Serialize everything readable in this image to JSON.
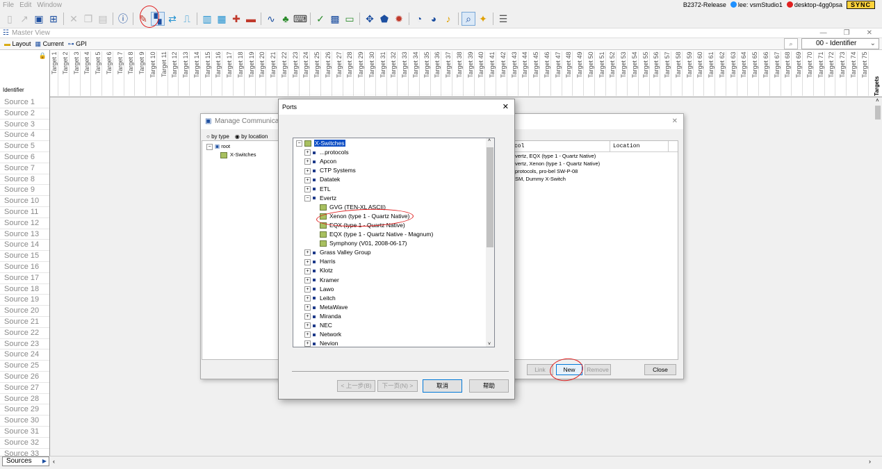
{
  "menu": {
    "items": [
      "File",
      "Edit",
      "Window"
    ]
  },
  "status": {
    "build": "B2372-Release",
    "user": "lee: vsmStudio1",
    "host": "desktop-4gg0psa",
    "sync": "SYNC",
    "user_color": "#1e90ff",
    "host_color": "#e02020"
  },
  "toolbar": {
    "icons": [
      "new-icon",
      "open-icon",
      "save-icon",
      "save-all-icon",
      "delete-icon",
      "copy-icon",
      "paste-icon",
      "info-icon",
      "tools-icon",
      "comm-manager-icon",
      "routing-icon",
      "gpi-icon",
      "panel-icon",
      "matrix-icon",
      "plug-icon",
      "device-icon",
      "signal-icon",
      "tally-icon",
      "keyboard-icon",
      "folder-icon",
      "grid-icon",
      "card-icon",
      "network-icon",
      "shield-icon",
      "gear-icon",
      "timer-icon",
      "clock-icon",
      "note-icon",
      "search-icon",
      "wizard-icon",
      "list-icon"
    ]
  },
  "master_view": {
    "title": "Master View"
  },
  "tabs": [
    {
      "label": "Layout"
    },
    {
      "label": "Current"
    },
    {
      "label": "GPI"
    }
  ],
  "identifier": {
    "selected": "00 - Identifier",
    "label": "Identifier"
  },
  "targets": [
    "Target 1",
    "Target 2",
    "Target 3",
    "Target 4",
    "Target 5",
    "Target 6",
    "Target 7",
    "Target 8",
    "Target 9",
    "Target 10",
    "Target 11",
    "Target 12",
    "Target 13",
    "Target 14",
    "Target 15",
    "Target 16",
    "Target 17",
    "Target 18",
    "Target 19",
    "Target 20",
    "Target 21",
    "Target 22",
    "Target 23",
    "Target 24",
    "Target 25",
    "Target 26",
    "Target 27",
    "Target 28",
    "Target 29",
    "Target 30",
    "Target 31",
    "Target 32",
    "Target 33",
    "Target 34",
    "Target 35",
    "Target 36",
    "Target 37",
    "Target 38",
    "Target 39",
    "Target 40",
    "Target 41",
    "Target 42",
    "Target 43",
    "Target 44",
    "Target 45",
    "Target 46",
    "Target 47",
    "Target 48",
    "Target 49",
    "Target 50",
    "Target 51",
    "Target 52",
    "Target 53",
    "Target 54",
    "Target 55",
    "Target 56",
    "Target 57",
    "Target 58",
    "Target 59",
    "Target 60",
    "Target 61",
    "Target 62",
    "Target 63",
    "Target 64",
    "Target 65",
    "Target 66",
    "Target 67",
    "Target 68",
    "Target 69",
    "Target 70",
    "Target 71",
    "Target 72",
    "Target 73",
    "Target 74",
    "Target 75"
  ],
  "targets_tab": "Targets",
  "sources": [
    "Source 1",
    "Source 2",
    "Source 3",
    "Source 4",
    "Source 5",
    "Source 6",
    "Source 7",
    "Source 8",
    "Source 9",
    "Source 10",
    "Source 11",
    "Source 12",
    "Source 13",
    "Source 14",
    "Source 15",
    "Source 16",
    "Source 17",
    "Source 18",
    "Source 19",
    "Source 20",
    "Source 21",
    "Source 22",
    "Source 23",
    "Source 24",
    "Source 25",
    "Source 26",
    "Source 27",
    "Source 28",
    "Source 29",
    "Source 30",
    "Source 31",
    "Source 32",
    "Source 33"
  ],
  "sources_button": "Sources",
  "manage_dialog": {
    "title": "Manage Communication",
    "by_type": "by type",
    "by_location": "by location",
    "tree": {
      "root": "root",
      "child": "X-Switches"
    },
    "columns": {
      "protocol": "col",
      "location": "Location"
    },
    "rows": [
      "vertz, EQX (type 1 - Quartz Native)",
      "vertz, Xenon (type 1 - Quartz Native)",
      "protocols, pro-bel SW-P-08",
      "SM, Dummy X-Switch"
    ],
    "buttons": {
      "link": "Link",
      "new": "New",
      "remove": "Remove",
      "close": "Close"
    }
  },
  "ports_dialog": {
    "title": "Ports",
    "root": "X-Switches",
    "items": [
      {
        "label": "...protocols"
      },
      {
        "label": "Apcon"
      },
      {
        "label": "CTP Systems"
      },
      {
        "label": "Datatek"
      },
      {
        "label": "ETL"
      },
      {
        "label": "Evertz"
      },
      {
        "label": "Grass Valley Group"
      },
      {
        "label": "Harris"
      },
      {
        "label": "Klotz"
      },
      {
        "label": "Kramer"
      },
      {
        "label": "Lawo"
      },
      {
        "label": "Leitch"
      },
      {
        "label": "MetaWave"
      },
      {
        "label": "Miranda"
      },
      {
        "label": "NEC"
      },
      {
        "label": "Network"
      },
      {
        "label": "Nevion"
      }
    ],
    "evertz_children": [
      "GVG (TEN-XL ASCII)",
      "Xenon (type 1 - Quartz Native)",
      "EQX (type 1 - Quartz Native)",
      "EQX (type 1 - Quartz Native - Magnum)",
      "Symphony (V01, 2008-06-17)"
    ],
    "buttons": {
      "back": "< 上一步(B)",
      "next": "下一页(N) >",
      "cancel": "取消",
      "help": "帮助"
    }
  }
}
